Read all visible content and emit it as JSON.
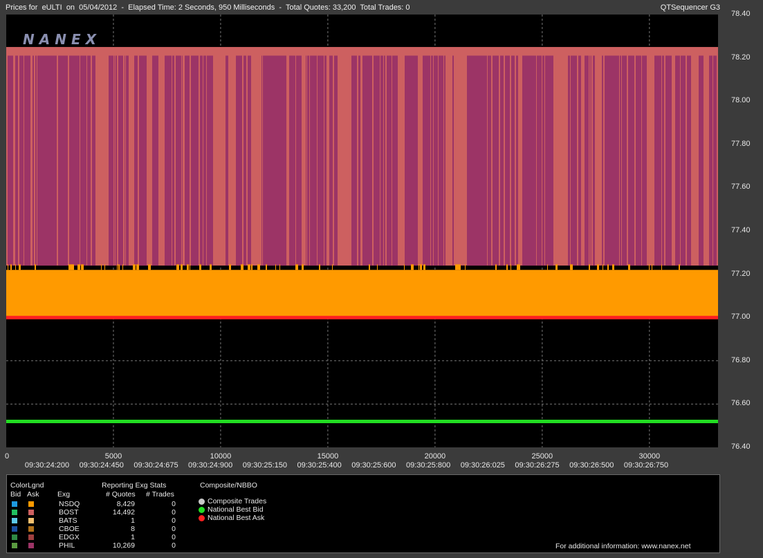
{
  "header": {
    "title": "Prices for  eULTI  on  05/04/2012  -  Elapsed Time: 2 Seconds, 950 Milliseconds  -  Total Quotes: 33,200  Total Trades: 0",
    "brand": "QTSequencer G3",
    "logo": "NANEX"
  },
  "chart_data": {
    "type": "line",
    "title": "",
    "ylim": [
      76.4,
      78.4
    ],
    "xlim": [
      0,
      33200
    ],
    "y_ticks": [
      "78.40",
      "78.20",
      "78.00",
      "77.80",
      "77.60",
      "77.40",
      "77.20",
      "77.00",
      "76.80",
      "76.60",
      "76.40"
    ],
    "x_ticks": [
      "0",
      "5000",
      "10000",
      "15000",
      "20000",
      "25000",
      "30000"
    ],
    "x_time_labels": [
      "09:30:24:200",
      "09:30:24:450",
      "09:30:24:675",
      "09:30:24:900",
      "09:30:25:150",
      "09:30:25:400",
      "09:30:25:600",
      "09:30:25:800",
      "09:30:26:025",
      "09:30:26:275",
      "09:30:26:500",
      "09:30:26:750"
    ],
    "grid": true,
    "series": [
      {
        "name": "National Best Bid",
        "color": "#22dd22",
        "value": 76.52
      },
      {
        "name": "National Best Ask",
        "color": "#ff2020",
        "value": 77.0
      },
      {
        "name": "NSDQ Ask",
        "color": "#ff9a00",
        "low": 77.0,
        "high": 77.22
      },
      {
        "name": "BOST Ask",
        "color": "#cd6060",
        "low": 77.24,
        "high": 78.25
      },
      {
        "name": "PHIL Ask",
        "color": "#9c3466",
        "low": 77.24,
        "high": 78.21
      }
    ]
  },
  "legend": {
    "color_legend_label": "ColorLgnd",
    "bid_label": "Bid",
    "ask_label": "Ask",
    "exg_label": "Exg",
    "stats_title": "Reporting Exg Stats",
    "quotes_label": "# Quotes",
    "trades_label": "# Trades",
    "composite_title": "Composite/NBBO",
    "exchanges": [
      {
        "name": "NSDQ",
        "bid_color": "#1e9ae0",
        "ask_color": "#ff9a00",
        "quotes": "8,429",
        "trades": "0"
      },
      {
        "name": "BOST",
        "bid_color": "#21c060",
        "ask_color": "#cd6060",
        "quotes": "14,492",
        "trades": "0"
      },
      {
        "name": "BATS",
        "bid_color": "#5cc8e8",
        "ask_color": "#f4c070",
        "quotes": "1",
        "trades": "0"
      },
      {
        "name": "CBOE",
        "bid_color": "#1a4fa0",
        "ask_color": "#b07018",
        "quotes": "8",
        "trades": "0"
      },
      {
        "name": "EDGX",
        "bid_color": "#2f8a45",
        "ask_color": "#a04040",
        "quotes": "1",
        "trades": "0"
      },
      {
        "name": "PHIL",
        "bid_color": "#5a9a40",
        "ask_color": "#9c3466",
        "quotes": "10,269",
        "trades": "0"
      }
    ],
    "composite": [
      {
        "label": "Composite Trades",
        "color": "#c8c8c8"
      },
      {
        "label": "National Best Bid",
        "color": "#22dd22"
      },
      {
        "label": "National Best Ask",
        "color": "#ff2020"
      }
    ],
    "footer": "For additional information: www.nanex.net"
  }
}
